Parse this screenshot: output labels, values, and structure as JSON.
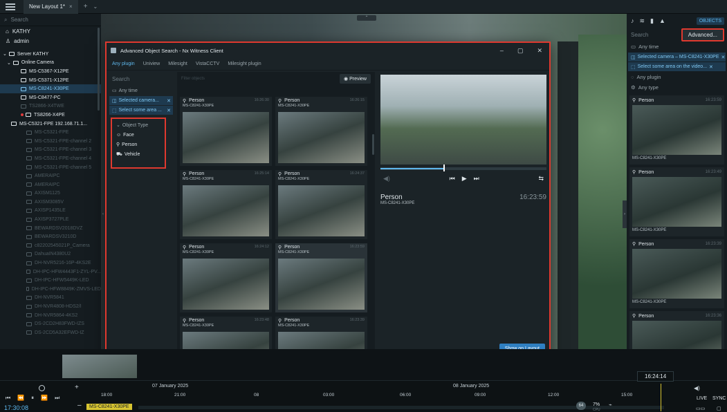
{
  "titlebar": {
    "tab_label": "New Layout 1*",
    "tab_close": "×",
    "new_tab": "+",
    "tabs_menu": "⌄",
    "cloud_icon": "cloud-icon",
    "help": "?",
    "minimize": "_",
    "maximize": "▢"
  },
  "left_panel": {
    "search_placeholder": "Search",
    "user_name": "KATHY",
    "user_role": "admin",
    "server": "Server KATHY",
    "group": "Online Camera",
    "cameras": [
      {
        "label": "MS-C5367-X12PE",
        "state": "normal"
      },
      {
        "label": "MS-C5371-X12PE",
        "state": "normal"
      },
      {
        "label": "MS-C8241-X30PE",
        "state": "selected"
      },
      {
        "label": "MS-C8477-PC",
        "state": "normal"
      },
      {
        "label": "TS2866-X4TWE",
        "state": "dim"
      },
      {
        "label": "TS8266-X4PE",
        "state": "recording"
      },
      {
        "label": "MS-C5321-FPE 192.168.71.1...",
        "state": "normal"
      },
      {
        "label": "MS-C5321-FPE",
        "state": "dim"
      },
      {
        "label": "MS-C5321-FPE-channel 2",
        "state": "dim"
      },
      {
        "label": "MS-C5321-FPE-channel 3",
        "state": "dim"
      },
      {
        "label": "MS-C5321-FPE-channel 4",
        "state": "dim"
      },
      {
        "label": "MS-C5321-FPE-channel 5",
        "state": "dim"
      },
      {
        "label": "AMERAIPC",
        "state": "dim"
      },
      {
        "label": "AMERAIPC",
        "state": "dim"
      },
      {
        "label": "AXISM1125",
        "state": "dim"
      },
      {
        "label": "AXISM3085V",
        "state": "dim"
      },
      {
        "label": "AXISP1435LE",
        "state": "dim"
      },
      {
        "label": "AXISP3727PLE",
        "state": "dim"
      },
      {
        "label": "BEWARDSV2018DVZ",
        "state": "dim"
      },
      {
        "label": "BEWARDSV3210D",
        "state": "dim"
      },
      {
        "label": "c82202545021P_Camera",
        "state": "dim"
      },
      {
        "label": "DahuaIN4380U2",
        "state": "dim"
      },
      {
        "label": "DH-NVR5216-16P-4KS2E",
        "state": "dim"
      },
      {
        "label": "DH-IPC-HFW4443F1-ZYL-PV...",
        "state": "dim"
      },
      {
        "label": "DH-IPC-HFW5449K-LED",
        "state": "dim"
      },
      {
        "label": "DH-IPC-HFW8849K-ZMVS-LED",
        "state": "dim"
      },
      {
        "label": "DH-NVR5841",
        "state": "dim"
      },
      {
        "label": "DH-NVR4808-HDS2/I",
        "state": "dim"
      },
      {
        "label": "DH-NVR5864-4KS2",
        "state": "dim"
      },
      {
        "label": "DS-2CD2H83FWD-IZS",
        "state": "dim"
      },
      {
        "label": "DS-2CD5A32EFWD-IZ",
        "state": "dim"
      }
    ]
  },
  "right_panel": {
    "objects_tab": "OBJECTS",
    "search_label": "Search",
    "advanced_button": "Advanced...",
    "any_time": "Any time",
    "selected_camera_chip": "Selected camera – MS-C8241-X30PE",
    "area_chip": "Select some area on the video...",
    "any_plugin": "Any plugin",
    "any_type": "Any type",
    "cards": [
      {
        "object": "Person",
        "time": "16:23:59",
        "camera": "MS-C8241-X30PE"
      },
      {
        "object": "Person",
        "time": "16:23:49",
        "camera": "MS-C8241-X30PE"
      },
      {
        "object": "Person",
        "time": "16:23:39",
        "camera": "MS-C8241-X30PE"
      },
      {
        "object": "Person",
        "time": "16:23:36",
        "camera": ""
      }
    ]
  },
  "modal": {
    "title": "Advanced Object Search - Nx Witness Client",
    "minimize": "–",
    "maximize": "▢",
    "close": "✕",
    "tabs": [
      "Any plugin",
      "Uniview",
      "Milesight",
      "VistaCCTV",
      "Milesight plugin"
    ],
    "filters": {
      "search_placeholder": "Search",
      "any_time": "Any time",
      "selected_camera": "Selected camera...",
      "select_area": "Select some area ...",
      "object_type_header": "Object Type",
      "types": [
        "Face",
        "Person",
        "Vehicle"
      ]
    },
    "grid": {
      "filter_placeholder": "Filter objects",
      "preview_button": "Preview",
      "cards": [
        {
          "object": "Person",
          "time": "16:26:30",
          "camera": "MS-C8241-X30PE"
        },
        {
          "object": "Person",
          "time": "16:26:15",
          "camera": "MS-C8241-X30PE"
        },
        {
          "object": "Person",
          "time": "16:25:14",
          "camera": "MS-C8241-X30PE"
        },
        {
          "object": "Person",
          "time": "16:24:37",
          "camera": "MS-C8241-X30PE"
        },
        {
          "object": "Person",
          "time": "16:24:12",
          "camera": "MS-C8241-X30PE"
        },
        {
          "object": "Person",
          "time": "16:23:59",
          "camera": "MS-C8241-X30PE"
        },
        {
          "object": "Person",
          "time": "16:23:48",
          "camera": "MS-C8241-X30PE"
        },
        {
          "object": "Person",
          "time": "16:23:39",
          "camera": "MS-C8241-X30PE"
        }
      ]
    },
    "preview": {
      "object": "Person",
      "time": "16:23:59",
      "camera": "MS-C8241-X30PE",
      "show_on_layout": "Show on Layout"
    }
  },
  "timeline": {
    "clock": "17:30:08",
    "date1": "07 January 2025",
    "date2": "08 January 2025",
    "live_time": "16:24:14",
    "major_ticks": [
      "18:00",
      "21:00",
      "08",
      "03:00",
      "06:00",
      "09:00",
      "12:00",
      "15:00"
    ],
    "camera_chip": "MS-C8241-X30PE",
    "stat_badge": "64",
    "cpu_percent": "7%",
    "cpu_label": "CPU",
    "live": "LIVE",
    "sync": "SYNC"
  }
}
